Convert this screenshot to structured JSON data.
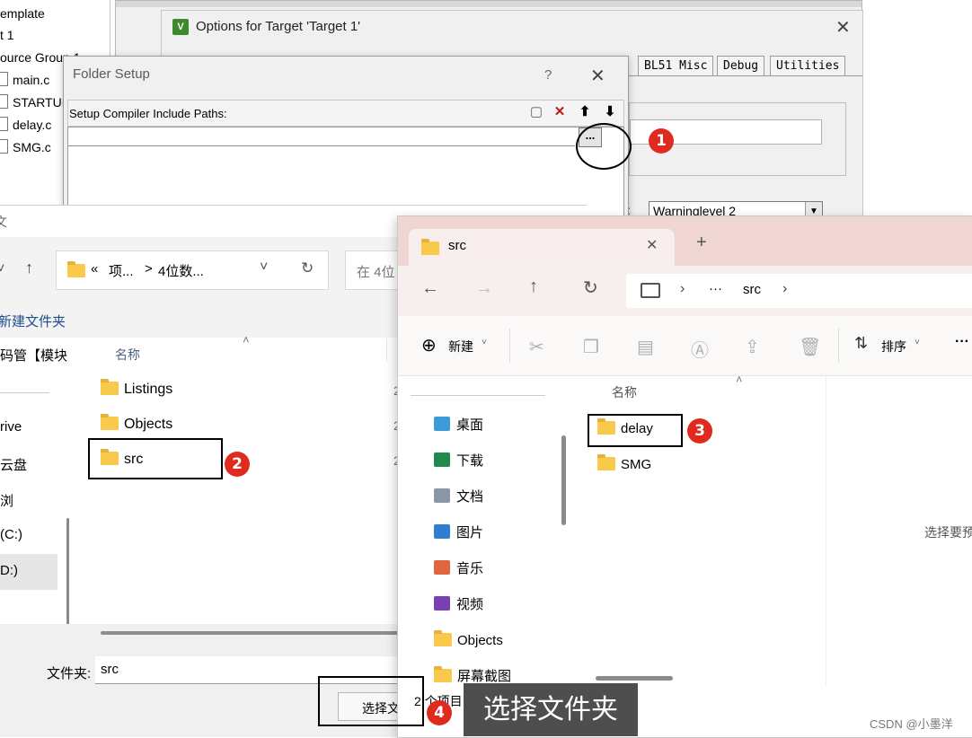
{
  "tree": {
    "items": [
      "emplate",
      "t 1",
      "ource Group 1",
      "main.c",
      "STARTUP",
      "delay.c",
      "SMG.c"
    ]
  },
  "options_dialog": {
    "title": "Options for Target 'Target 1'",
    "icon": "uvision-icon",
    "tabs_visible": [
      "BL51 Misc",
      "Debug",
      "Utilities"
    ],
    "warnings_label": "s:",
    "warnings_value": "Warninglevel 2"
  },
  "folder_setup": {
    "title": "Folder Setup",
    "help": "?",
    "label": "Setup Compiler Include Paths:",
    "browse_label": "...",
    "toolbar_icons": [
      "new-icon",
      "delete-icon",
      "move-up-icon",
      "move-down-icon"
    ]
  },
  "browse_dialog": {
    "title_fragment": "文",
    "breadcrumb": [
      "«",
      "项...",
      ">",
      "4位数..."
    ],
    "search_placeholder": "在 4位",
    "new_folder": "新建文件夹",
    "sidebar": [
      "码管【模块",
      "rive",
      "云盘",
      "浏",
      "(C:)",
      "D:)"
    ],
    "column_name": "名称",
    "items": [
      "Listings",
      "Objects",
      "src"
    ],
    "item_date_fragment": "2",
    "folder_label": "文件夹:",
    "folder_value": "src",
    "select_button": "选择文"
  },
  "explorer": {
    "tab_title": "src",
    "add_tab": "+",
    "address_more": "···",
    "address_folder": "src",
    "new_button": "新建",
    "sort_button": "排序",
    "more": "···",
    "column_name": "名称",
    "sidebar": [
      {
        "label": "桌面",
        "icon": "desktop-icon",
        "color": "#3d9ad9",
        "pinned": true
      },
      {
        "label": "下载",
        "icon": "download-icon",
        "color": "#1f8a4c",
        "pinned": true
      },
      {
        "label": "文档",
        "icon": "document-icon",
        "color": "#8a97a8",
        "pinned": true
      },
      {
        "label": "图片",
        "icon": "picture-icon",
        "color": "#2f7fd1",
        "pinned": true
      },
      {
        "label": "音乐",
        "icon": "music-icon",
        "color": "#e0663f",
        "pinned": true
      },
      {
        "label": "视频",
        "icon": "video-icon",
        "color": "#7a3fb3",
        "pinned": true
      },
      {
        "label": "Objects",
        "icon": "folder-icon",
        "color": "#f8c94a",
        "pinned": false
      },
      {
        "label": "屏幕截图",
        "icon": "folder-icon",
        "color": "#f8c94a",
        "pinned": false
      }
    ],
    "items": [
      "delay",
      "SMG"
    ],
    "preview_text": "选择要预",
    "status": "2 个项目"
  },
  "annotations": {
    "steps": [
      "1",
      "2",
      "3",
      "4"
    ],
    "tooltip": "选择文件夹",
    "badge_color": "#e02a1d"
  },
  "watermark": "CSDN @小墨洋"
}
